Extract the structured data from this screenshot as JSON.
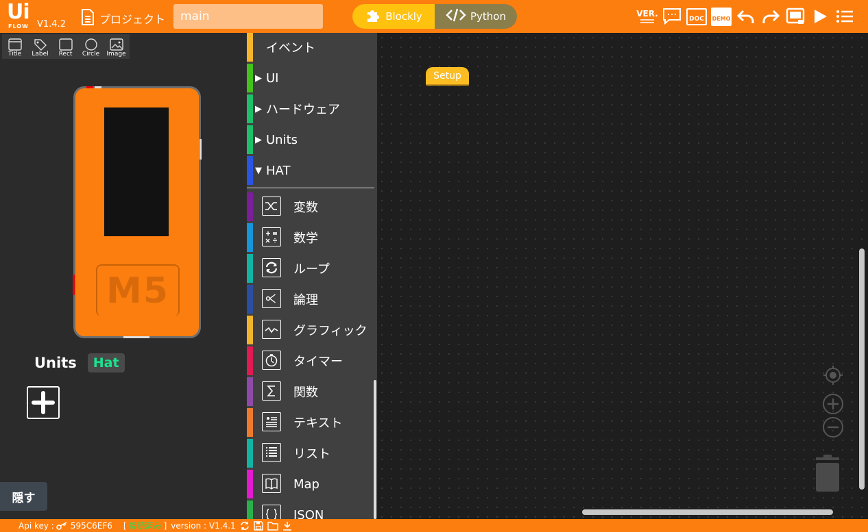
{
  "header": {
    "logo_text": "Ui",
    "logo_sub": "FLOW",
    "version": "V1.4.2",
    "project_label": "プロジェクト",
    "file_name_value": "main",
    "modes": [
      {
        "label": "Blockly",
        "active": true
      },
      {
        "label": "Python",
        "active": false
      }
    ],
    "toolbar_icons": [
      "ver-icon",
      "chat-icon",
      "doc-icon",
      "demo-icon",
      "undo-icon",
      "redo-icon",
      "device-icon",
      "run-icon",
      "menu-icon"
    ],
    "ver_text": "VER.",
    "doc_text": "DOC",
    "demo_text": "DEMO"
  },
  "left_panel": {
    "shapes": [
      "Title",
      "Label",
      "Rect",
      "Circle",
      "Image"
    ],
    "device_logo": "M5",
    "units_label": "Units",
    "hat_label": "Hat",
    "hide_label": "隠す"
  },
  "toolbox": {
    "top_categories": [
      {
        "label": "イベント",
        "color": "#f7b52c",
        "arrow": ""
      },
      {
        "label": "UI",
        "color": "#45c11c",
        "arrow": "▶"
      },
      {
        "label": "ハードウェア",
        "color": "#1fbf6a",
        "arrow": "▶"
      },
      {
        "label": "Units",
        "color": "#1fbf6a",
        "arrow": "▶"
      },
      {
        "label": "HAT",
        "color": "#2a55e0",
        "arrow": "▼"
      }
    ],
    "blocks": [
      {
        "label": "変数",
        "color": "#7a1f98",
        "icon": "shuffle-icon"
      },
      {
        "label": "数学",
        "color": "#1895d8",
        "icon": "math-icon"
      },
      {
        "label": "ループ",
        "color": "#12b3a3",
        "icon": "loop-icon"
      },
      {
        "label": "論理",
        "color": "#2a4fa0",
        "icon": "logic-icon"
      },
      {
        "label": "グラフィック",
        "color": "#f0b52c",
        "icon": "graph-icon"
      },
      {
        "label": "タイマー",
        "color": "#e01a52",
        "icon": "timer-icon"
      },
      {
        "label": "関数",
        "color": "#8e4aa6",
        "icon": "sigma-icon"
      },
      {
        "label": "テキスト",
        "color": "#ee7a2c",
        "icon": "text-icon"
      },
      {
        "label": "リスト",
        "color": "#12b3a3",
        "icon": "list-icon"
      },
      {
        "label": "Map",
        "color": "#e21ad0",
        "icon": "map-icon"
      },
      {
        "label": "JSON",
        "color": "#2ab04a",
        "icon": "json-icon"
      }
    ]
  },
  "workspace": {
    "setup_block": "Setup"
  },
  "status": {
    "api_key_label": "Api key :",
    "api_key": "595C6EF6",
    "connection": "接続済み",
    "version_text": "version : V1.4.1"
  }
}
